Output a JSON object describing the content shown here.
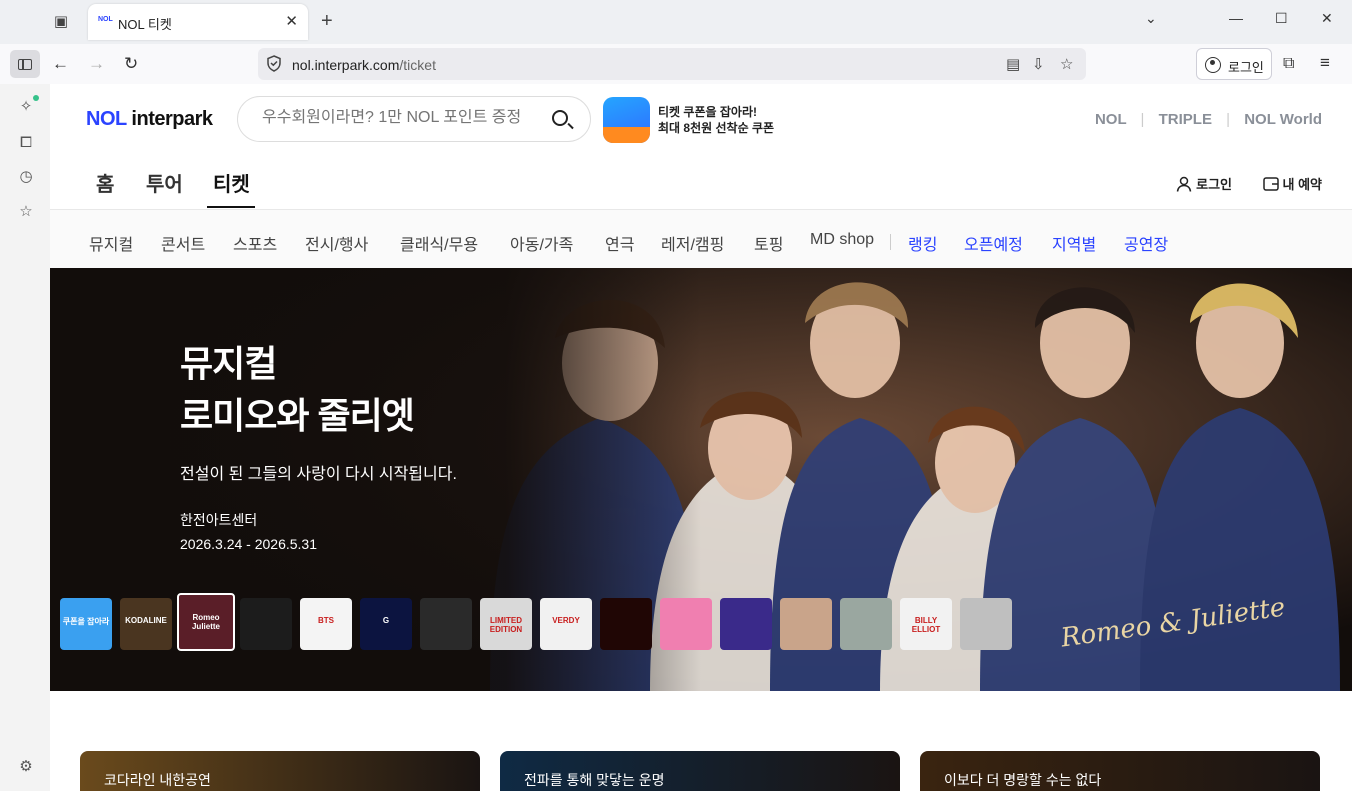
{
  "browser": {
    "tab_title": "NOL 티켓",
    "tab_favicon": "NOL",
    "url_host": "nol.interpark.com",
    "url_path": "/ticket",
    "login_label": "로그인"
  },
  "header": {
    "logo_nol": "NOL",
    "logo_rest": " interpark",
    "search_placeholder": "우수회원이라면? 1만 NOL 포인트 증정",
    "promo_line1": "티켓 쿠폰을 잡아라!",
    "promo_line2": "최대 8천원 선착순 쿠폰",
    "brands": [
      "NOL",
      "TRIPLE",
      "NOL World"
    ]
  },
  "mainnav": {
    "items": [
      "홈",
      "투어",
      "티켓"
    ],
    "active": "티켓",
    "login": "로그인",
    "reservation": "내 예약"
  },
  "categories": [
    "뮤지컬",
    "콘서트",
    "스포츠",
    "전시/행사",
    "클래식/무용",
    "아동/가족",
    "연극",
    "레저/캠핑",
    "토핑",
    "MD shop"
  ],
  "categories_blue": [
    "랭킹",
    "오픈예정",
    "지역별",
    "공연장"
  ],
  "hero": {
    "title_line1": "뮤지컬",
    "title_line2": "로미오와 줄리엣",
    "subtitle": "전설이 된 그들의 사랑이 다시 시작됩니다.",
    "venue": "한전아트센터",
    "dates": "2026.3.24 - 2026.5.31",
    "logo_text": "Romeo & Juliette",
    "thumbnails": [
      {
        "label": "쿠폰을 잡아라",
        "color": "#3aa0f0"
      },
      {
        "label": "KODALINE",
        "color": "#4a3520"
      },
      {
        "label": "Romeo Juliette",
        "color": "#5a1e28"
      },
      {
        "label": "",
        "color": "#1c1c1c"
      },
      {
        "label": "BTS",
        "color": "#f4f4f4"
      },
      {
        "label": "G",
        "color": "#0c1440"
      },
      {
        "label": "",
        "color": "#2a2a2a"
      },
      {
        "label": "LIMITED EDITION",
        "color": "#d9d9d9"
      },
      {
        "label": "VERDY",
        "color": "#f1f1f1"
      },
      {
        "label": "",
        "color": "#200605"
      },
      {
        "label": "",
        "color": "#f07fb0"
      },
      {
        "label": "",
        "color": "#3a2a8a"
      },
      {
        "label": "",
        "color": "#c9a48a"
      },
      {
        "label": "",
        "color": "#9aa7a0"
      },
      {
        "label": "BILLY ELLIOT",
        "color": "#f2f2f2"
      },
      {
        "label": "",
        "color": "#bfbfbf"
      }
    ]
  },
  "cards": [
    {
      "label": "코다라인 내한공연",
      "color": "#6a4a1c"
    },
    {
      "label": "전파를 통해 맞닿는 운명",
      "color": "#0f2a44"
    },
    {
      "label": "이보다 더 명랑할 수는 없다",
      "color": "#3a2410"
    }
  ]
}
